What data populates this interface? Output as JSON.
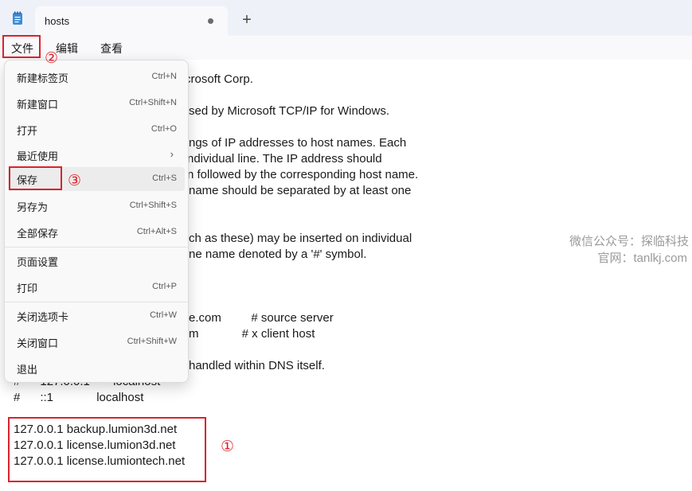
{
  "tab": {
    "title": "hosts",
    "new_tab": "+"
  },
  "menubar": {
    "file": "文件",
    "edit": "编辑",
    "view": "查看"
  },
  "editor_lines": [
    "crosoft Corp.",
    "sed by Microsoft TCP/IP for Windows.",
    "ngs of IP addresses to host names. Each",
    "ndividual line. The IP address should",
    "n followed by the corresponding host name.",
    "name should be separated by at least one",
    "ch as these) may be inserted on individual",
    "ne name denoted by a '#' symbol.",
    "e.com         # source server",
    "m             # x client host",
    "handled within DNS itself.",
    "#      127.0.0.1       localhost",
    "#      ::1             localhost",
    "127.0.0.1 backup.lumion3d.net",
    "127.0.0.1 license.lumion3d.net",
    "127.0.0.1 license.lumiontech.net"
  ],
  "file_menu": [
    {
      "label": "新建标签页",
      "shortcut": "Ctrl+N"
    },
    {
      "label": "新建窗口",
      "shortcut": "Ctrl+Shift+N"
    },
    {
      "label": "打开",
      "shortcut": "Ctrl+O"
    },
    {
      "label": "最近使用",
      "shortcut": "›"
    },
    {
      "label": "保存",
      "shortcut": "Ctrl+S"
    },
    {
      "label": "另存为",
      "shortcut": "Ctrl+Shift+S"
    },
    {
      "label": "全部保存",
      "shortcut": "Ctrl+Alt+S"
    },
    {
      "label": "页面设置",
      "shortcut": ""
    },
    {
      "label": "打印",
      "shortcut": "Ctrl+P"
    },
    {
      "label": "关闭选项卡",
      "shortcut": "Ctrl+W"
    },
    {
      "label": "关闭窗口",
      "shortcut": "Ctrl+Shift+W"
    },
    {
      "label": "退出",
      "shortcut": ""
    }
  ],
  "annotations": {
    "one": "①",
    "two": "②",
    "three": "③"
  },
  "watermark": {
    "line1": "微信公众号：探临科技",
    "line2": "官网：tanlkj.com"
  },
  "colors": {
    "highlight_red": "#d9232d",
    "menu_bg": "#f9f9f9",
    "titlebar_bg": "#eef2f8"
  }
}
